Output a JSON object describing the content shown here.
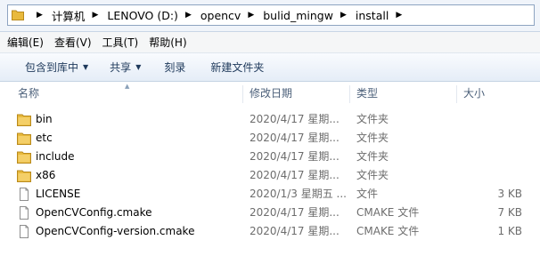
{
  "address": {
    "crumbs": [
      "计算机",
      "LENOVO (D:)",
      "opencv",
      "bulid_mingw",
      "install"
    ]
  },
  "menu": {
    "edit": "编辑(E)",
    "view": "查看(V)",
    "tools": "工具(T)",
    "help": "帮助(H)"
  },
  "toolbar": {
    "include_library": "包含到库中",
    "share": "共享",
    "burn": "刻录",
    "new_folder": "新建文件夹"
  },
  "columns": {
    "name": "名称",
    "date": "修改日期",
    "type": "类型",
    "size": "大小"
  },
  "files": [
    {
      "name": "bin",
      "date": "2020/4/17 星期...",
      "type": "文件夹",
      "size": "",
      "icon": "folder-icon"
    },
    {
      "name": "etc",
      "date": "2020/4/17 星期...",
      "type": "文件夹",
      "size": "",
      "icon": "folder-icon"
    },
    {
      "name": "include",
      "date": "2020/4/17 星期...",
      "type": "文件夹",
      "size": "",
      "icon": "folder-icon"
    },
    {
      "name": "x86",
      "date": "2020/4/17 星期...",
      "type": "文件夹",
      "size": "",
      "icon": "folder-icon"
    },
    {
      "name": "LICENSE",
      "date": "2020/1/3 星期五 ...",
      "type": "文件",
      "size": "3 KB",
      "icon": "file-icon"
    },
    {
      "name": "OpenCVConfig.cmake",
      "date": "2020/4/17 星期...",
      "type": "CMAKE 文件",
      "size": "7 KB",
      "icon": "file-icon"
    },
    {
      "name": "OpenCVConfig-version.cmake",
      "date": "2020/4/17 星期...",
      "type": "CMAKE 文件",
      "size": "1 KB",
      "icon": "file-icon"
    }
  ],
  "colors": {
    "folder": "#e8b93c",
    "accent": "#1e395b"
  }
}
